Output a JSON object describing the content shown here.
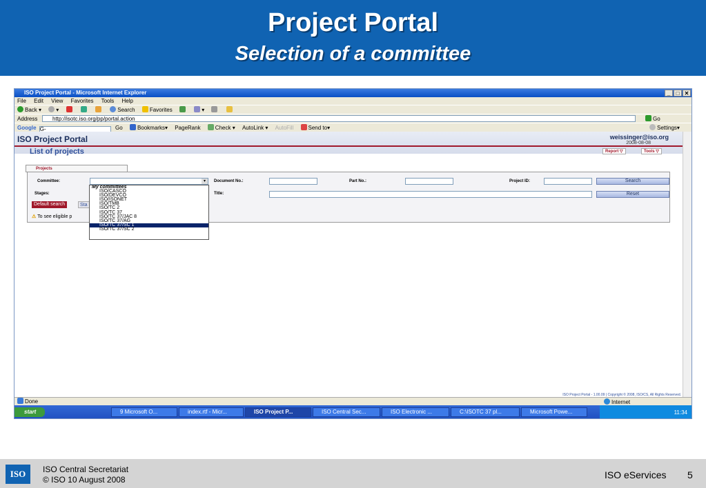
{
  "slide": {
    "title": "Project Portal",
    "subtitle": "Selection of a committee",
    "footer": {
      "org": "ISO Central Secretariat",
      "copyright": "© ISO 10 August 2008",
      "service": "ISO eServices",
      "page_number": "5",
      "logo_text": "ISO"
    }
  },
  "browser": {
    "window_title": "ISO Project Portal - Microsoft Internet Explorer",
    "menu": [
      "File",
      "Edit",
      "View",
      "Favorites",
      "Tools",
      "Help"
    ],
    "toolbar": {
      "back": "Back",
      "search": "Search",
      "favorites": "Favorites"
    },
    "address": {
      "label": "Address",
      "url": "http://isotc.iso.org/pp/portal.action",
      "go": "Go"
    },
    "google_bar": {
      "logo": "Google",
      "input": "G-",
      "go": "Go",
      "bookmarks": "Bookmarks",
      "pagerank": "PageRank",
      "check": "Check",
      "autolink": "AutoLink",
      "autofill": "AutoFill",
      "send_to": "Send to",
      "settings": "Settings"
    },
    "status": {
      "text": "Done",
      "zone": "Internet"
    }
  },
  "portal": {
    "title": "ISO Project Portal",
    "user_email": "weissinger@iso.org",
    "user_date": "2008-08-08",
    "list_title": "List of projects",
    "report_btn": "Report",
    "tools_btn": "Tools",
    "tab_label": "Projects",
    "form": {
      "committee_label": "Committee:",
      "document_label": "Document No.:",
      "part_label": "Part No.:",
      "project_label": "Project ID:",
      "stages_label": "Stages:",
      "title_label": "Title:",
      "search_button": "Search",
      "reset_button": "Reset",
      "default_search": "Default search",
      "stages_button": "Sta",
      "hint": "To see eligible p"
    },
    "dropdown": {
      "group": "My committees",
      "options": [
        "ISO/CASCO",
        "ISO/DEVCO",
        "ISO/ISONET",
        "ISO/TMB",
        "ISO/TC 2",
        "ISO/TC 37",
        "ISO/TC 37/JAC 8",
        "ISO/TC 37/AG",
        "ISO/TC 37/SC 1",
        "ISO/TC 37/SC 2"
      ],
      "selected_index": 8
    },
    "copyright": "ISO Project Portal - 1.00.09 | Copyright © 2008, ISO/CS, All Rights Reserved."
  },
  "taskbar": {
    "start": "start",
    "tasks": [
      "9 Microsoft O...",
      "index.rtf - Micr...",
      "ISO Project P...",
      "ISO Central Sec...",
      "ISO Electronic ...",
      "C:\\ISOTC 37 pl...",
      "Microsoft Powe..."
    ],
    "active_index": 2,
    "clock": "11:34"
  }
}
